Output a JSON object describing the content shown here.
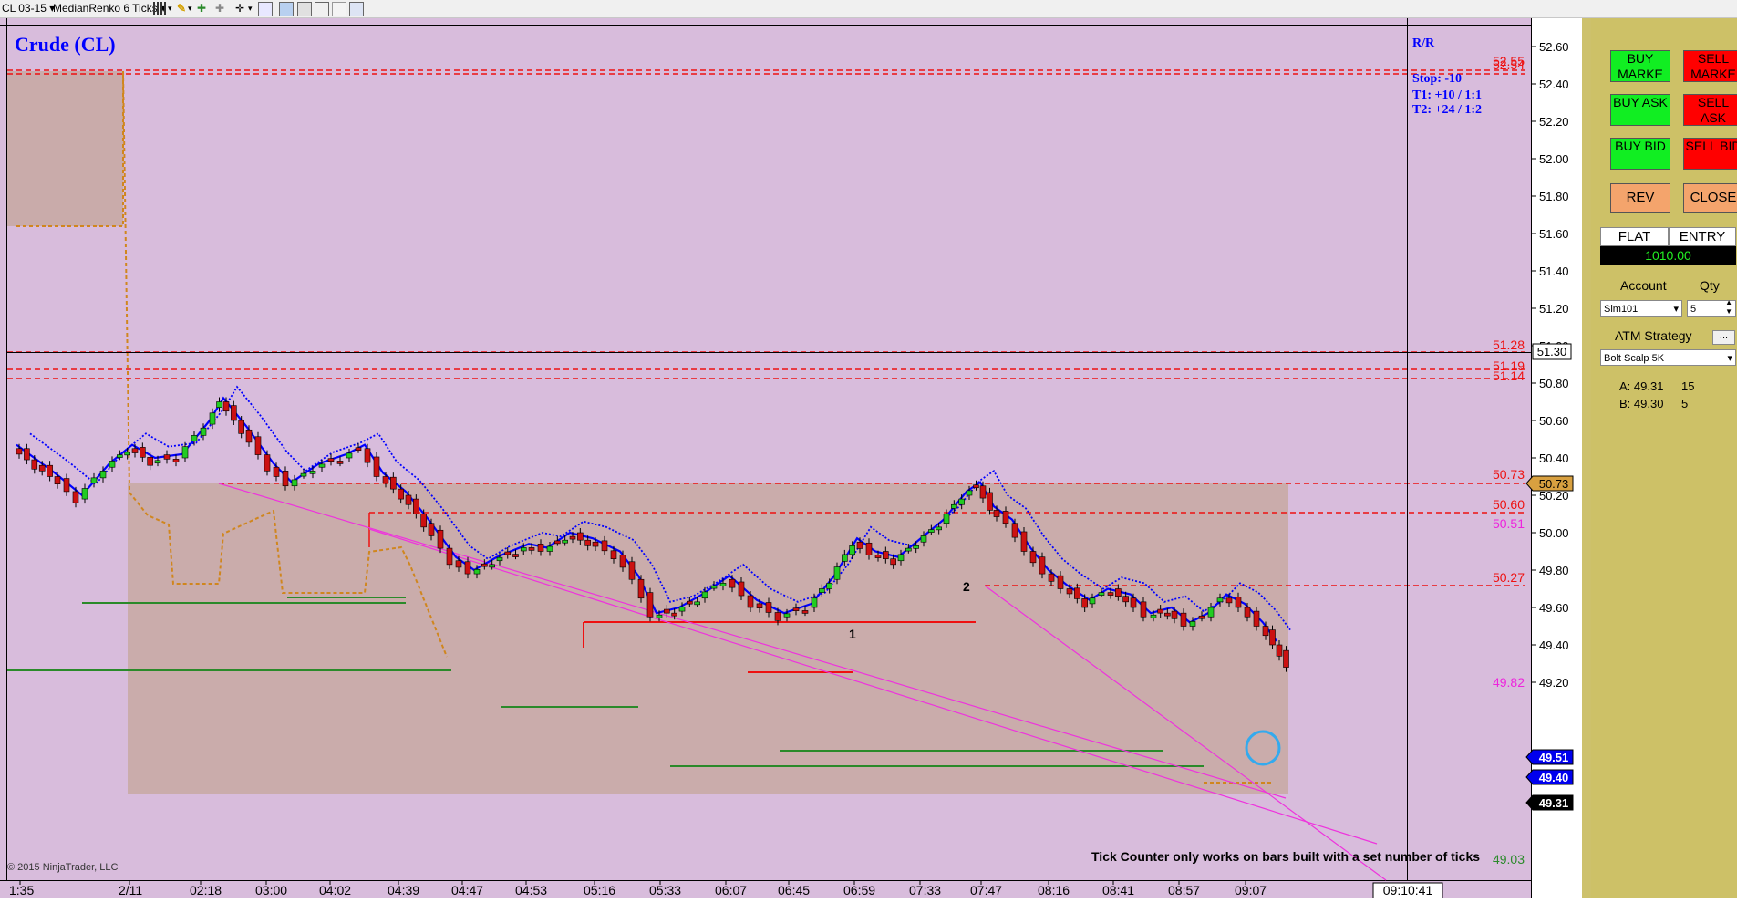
{
  "toolbar": {
    "instrument": "CL 03-15",
    "bar_type": "MedianRenko 6 Ticks"
  },
  "chart": {
    "title": "Crude (CL)",
    "copyright": "© 2015 NinjaTrader, LLC",
    "notice": "Tick Counter only works on bars built with a set number of ticks",
    "rr": {
      "header": "R/R",
      "stop": "Stop:  -10",
      "t1": "T1:  +10  /   1:1",
      "t2": "T2:  +24  /   1:2"
    },
    "price_axis": [
      "52.60",
      "52.40",
      "52.20",
      "52.00",
      "51.80",
      "51.60",
      "51.40",
      "51.20",
      "51.00",
      "50.80",
      "50.60",
      "50.40",
      "50.20",
      "50.00",
      "49.80",
      "49.60",
      "49.40",
      "49.20"
    ],
    "time_axis": [
      "1:35",
      "2/11",
      "02:18",
      "03:00",
      "04:02",
      "04:39",
      "04:47",
      "04:53",
      "05:16",
      "05:33",
      "06:07",
      "06:45",
      "06:59",
      "07:33",
      "07:47",
      "08:16",
      "08:41",
      "08:57",
      "09:07"
    ],
    "time_cursor": "09:10:41",
    "level_labels": {
      "l5255": "52.55",
      "l5254": "52.54",
      "l5128": "51.28",
      "l5119": "51.19",
      "l5114": "51.14",
      "l5073": "50.73",
      "l5060": "50.60",
      "l5051": "50.51",
      "l5027": "50.27",
      "l4982": "49.82",
      "l4903": "49.03"
    },
    "axis_markers": {
      "crosshair": "51.30",
      "high": "50.73",
      "blue1": "49.51",
      "blue2": "49.40",
      "last": "49.31"
    },
    "swing_labels": {
      "one": "1",
      "two": "2"
    },
    "colors": {
      "background": "#d8bcdc",
      "up": "#22cc22",
      "down": "#cc1111",
      "ma": "#0000ff",
      "trend": "#ee33dd",
      "level": "#ee1111"
    }
  },
  "panel": {
    "buy_market": "BUY MARKE",
    "sell_market": "SELL MARKE",
    "buy_ask": "BUY ASK",
    "sell_ask": "SELL ASK",
    "buy_bid": "BUY BID",
    "sell_bid": "SELL BID",
    "rev": "REV",
    "close": "CLOSE",
    "flat": "FLAT",
    "entry": "ENTRY",
    "pnl": "1010.00",
    "account_label": "Account",
    "qty_label": "Qty",
    "account_value": "Sim101",
    "qty_value": "5",
    "atm_label": "ATM Strategy",
    "atm_more": "...",
    "atm_value": "Bolt Scalp 5K",
    "ask_label": "A: 49.31",
    "ask_size": "15",
    "bid_label": "B: 49.30",
    "bid_size": "5"
  }
}
